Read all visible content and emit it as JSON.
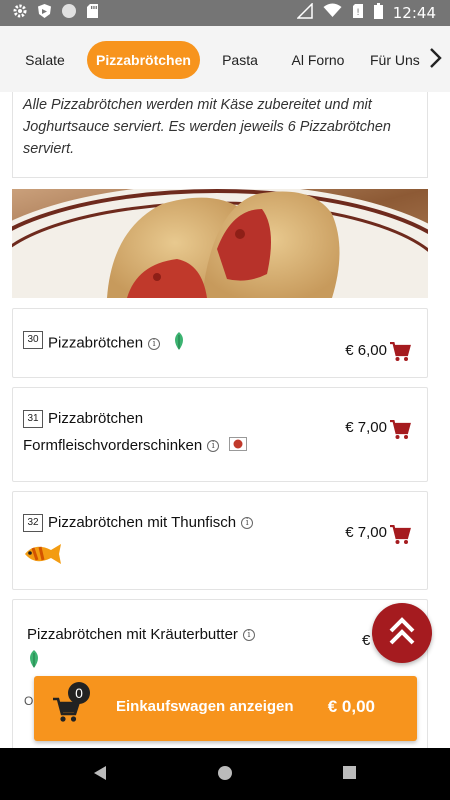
{
  "status_bar": {
    "time": "12:44",
    "left_icons": [
      "gear-icon",
      "shield-icon",
      "circle-icon",
      "sd-card-icon"
    ],
    "right_icons": [
      "signal-off-icon",
      "wifi-icon",
      "no-sim-icon",
      "battery-icon"
    ]
  },
  "tabs": {
    "items": [
      {
        "label": "Salate",
        "active": false
      },
      {
        "label": "Pizzabrötchen",
        "active": true
      },
      {
        "label": "Pasta",
        "active": false
      },
      {
        "label": "Al Forno",
        "active": false
      },
      {
        "label": "Für Uns",
        "active": false
      }
    ],
    "accent": "#f7941d"
  },
  "category": {
    "description": "Alle Pizzabrötchen werden mit Käse zubereitet und mit Joghurtsauce serviert. Es werden jeweils 6 Pizzabrötchen serviert."
  },
  "items": [
    {
      "number": "30",
      "name": "Pizzabrötchen",
      "name_line2": "",
      "price": "€ 6,00",
      "icon": "leaf-icon"
    },
    {
      "number": "31",
      "name": "Pizzabrötchen",
      "name_line2": "Formfleischvorderschinken",
      "price": "€ 7,00",
      "icon": "ham-icon"
    },
    {
      "number": "32",
      "name": "Pizzabrötchen mit Thunfisch",
      "name_line2": "",
      "price": "€ 7,00",
      "icon": "fish-icon"
    },
    {
      "number": "",
      "name": "Pizzabrötchen mit Kräuterbutter",
      "name_line2": "",
      "price": "€ 2,",
      "icon": "leaf-icon"
    }
  ],
  "cart": {
    "label": "Einkaufswagen anzeigen",
    "total": "€ 0,00",
    "count": "0",
    "behind_text": "O"
  },
  "colors": {
    "brand_orange": "#f7941d",
    "cart_red": "#a51b1f"
  }
}
